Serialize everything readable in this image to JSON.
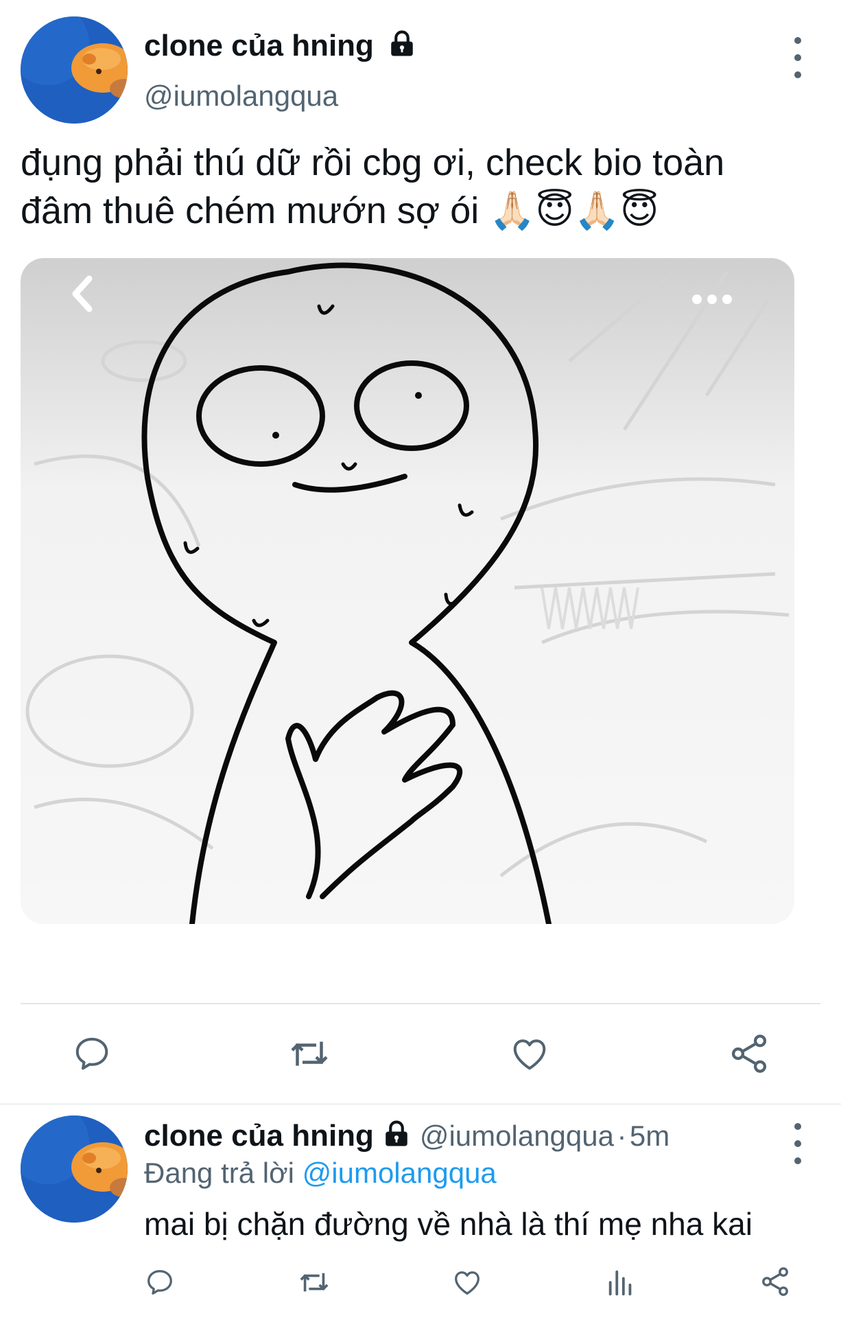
{
  "main_tweet": {
    "author_name": "clone của hning",
    "author_handle": "@iumolangqua",
    "text_line1": "đụng phải thú dữ rồi cbg ơi, check bio toàn",
    "text_line2": "đâm thuê chém mướn sợ ói 🙏🏻😇🙏🏻😇",
    "actions": [
      "reply-icon",
      "retweet-icon",
      "like-icon",
      "share-icon"
    ]
  },
  "reply_tweet": {
    "author_name": "clone của hning",
    "author_handle": "@iumolangqua",
    "separator": "·",
    "time": "5m",
    "replying_prefix": "Đang trả lời",
    "replying_to": "@iumolangqua",
    "text": "mai bị chặn đường về nhà là thí mẹ nha kai",
    "actions": [
      "reply-icon",
      "retweet-icon",
      "like-icon",
      "analytics-icon",
      "share-icon"
    ]
  },
  "colors": {
    "primary_text": "#0f1419",
    "secondary_text": "#536471",
    "link": "#1d9bf0",
    "divider": "#e2e6e9",
    "avatar_bg": "#1f5fbf",
    "avatar_blob": "#f19a38"
  }
}
